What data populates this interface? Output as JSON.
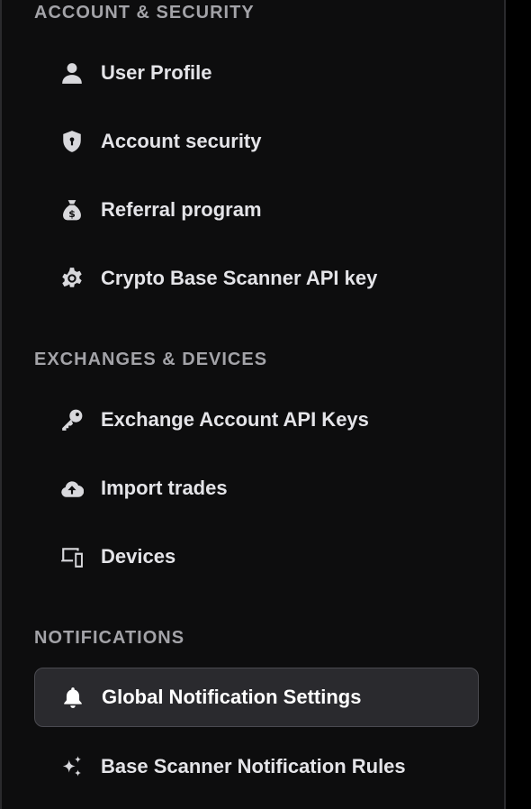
{
  "sections": {
    "account": {
      "title": "ACCOUNT & SECURITY",
      "items": [
        {
          "label": "User Profile",
          "icon": "user-icon"
        },
        {
          "label": "Account security",
          "icon": "shield-icon"
        },
        {
          "label": "Referral program",
          "icon": "money-bag-icon"
        },
        {
          "label": "Crypto Base Scanner API key",
          "icon": "gear-icon"
        }
      ]
    },
    "exchanges": {
      "title": "EXCHANGES & DEVICES",
      "items": [
        {
          "label": "Exchange Account API Keys",
          "icon": "key-icon"
        },
        {
          "label": "Import trades",
          "icon": "cloud-upload-icon"
        },
        {
          "label": "Devices",
          "icon": "devices-icon"
        }
      ]
    },
    "notifications": {
      "title": "NOTIFICATIONS",
      "items": [
        {
          "label": "Global Notification Settings",
          "icon": "bell-icon",
          "active": true
        },
        {
          "label": "Base Scanner Notification Rules",
          "icon": "sparkles-icon"
        }
      ]
    }
  },
  "colors": {
    "background": "#0d0d0e",
    "header_text": "#a3a3a8",
    "item_text": "#e4e4e8",
    "active_bg": "#2a2a2e",
    "active_border": "#4a4a50"
  }
}
